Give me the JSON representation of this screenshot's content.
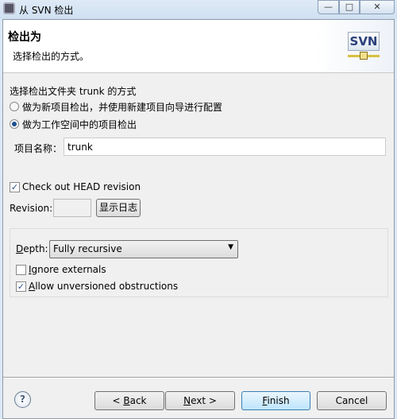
{
  "window": {
    "title": "从 SVN 检出",
    "minimize": "—",
    "maximize": "□",
    "close": "✕"
  },
  "banner": {
    "title": "检出为",
    "subtitle": "选择检出的方式。",
    "logo": "SVN"
  },
  "options": {
    "heading": "选择检出文件夹 trunk 的方式",
    "radio_new_project": {
      "label": "做为新项目检出，并使用新建项目向导进行配置",
      "selected": false
    },
    "radio_workspace": {
      "label": "做为工作空间中的项目检出",
      "selected": true
    },
    "project_name_label": "项目名称：",
    "project_name_value": "trunk"
  },
  "revision": {
    "head_checkbox_label": "Check out HEAD revision",
    "head_checked": true,
    "revision_label": "Revision:",
    "revision_value": "",
    "show_log_button": "显示日志"
  },
  "group": {
    "depth_label_u": "D",
    "depth_label_rest": "epth:",
    "depth_value": "Fully recursive",
    "ignore_externals_u": "I",
    "ignore_externals_rest": "gnore externals",
    "ignore_checked": false,
    "allow_unversioned_u": "A",
    "allow_unversioned_rest": "llow unversioned obstructions",
    "allow_checked": true
  },
  "footer": {
    "help": "?",
    "back_pre": "< ",
    "back_u": "B",
    "back_rest": "ack",
    "next_u": "N",
    "next_rest": "ext >",
    "finish_u": "F",
    "finish_rest": "inish",
    "cancel": "Cancel"
  }
}
